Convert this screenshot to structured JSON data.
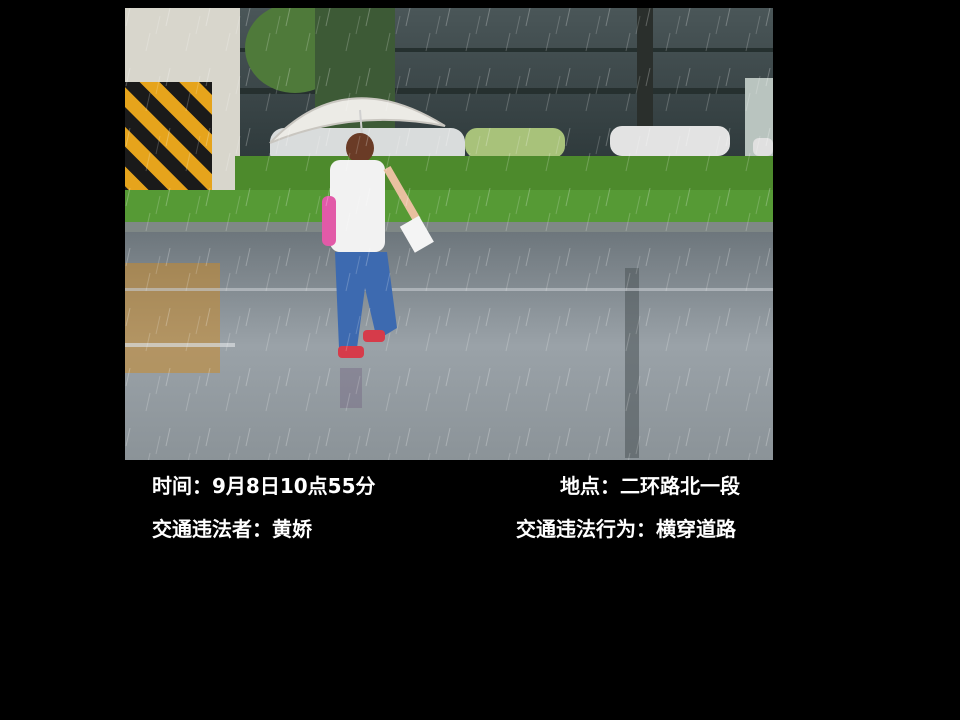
{
  "photo": {
    "subject": "woman-with-umbrella-crossing-wet-road",
    "colors": {
      "sky": "#8c9aa0",
      "building": "#3a4a4d",
      "grass": "#4a8a2e",
      "road": "#8a9096",
      "hazard_yellow": "#e6a41c",
      "hazard_black": "#1a1a1a"
    }
  },
  "caption": {
    "time": "时间：9月8日10点55分",
    "location": "地点：二环路北一段",
    "violator": "交通违法者：黄娇",
    "behavior": "交通违法行为：横穿道路"
  }
}
